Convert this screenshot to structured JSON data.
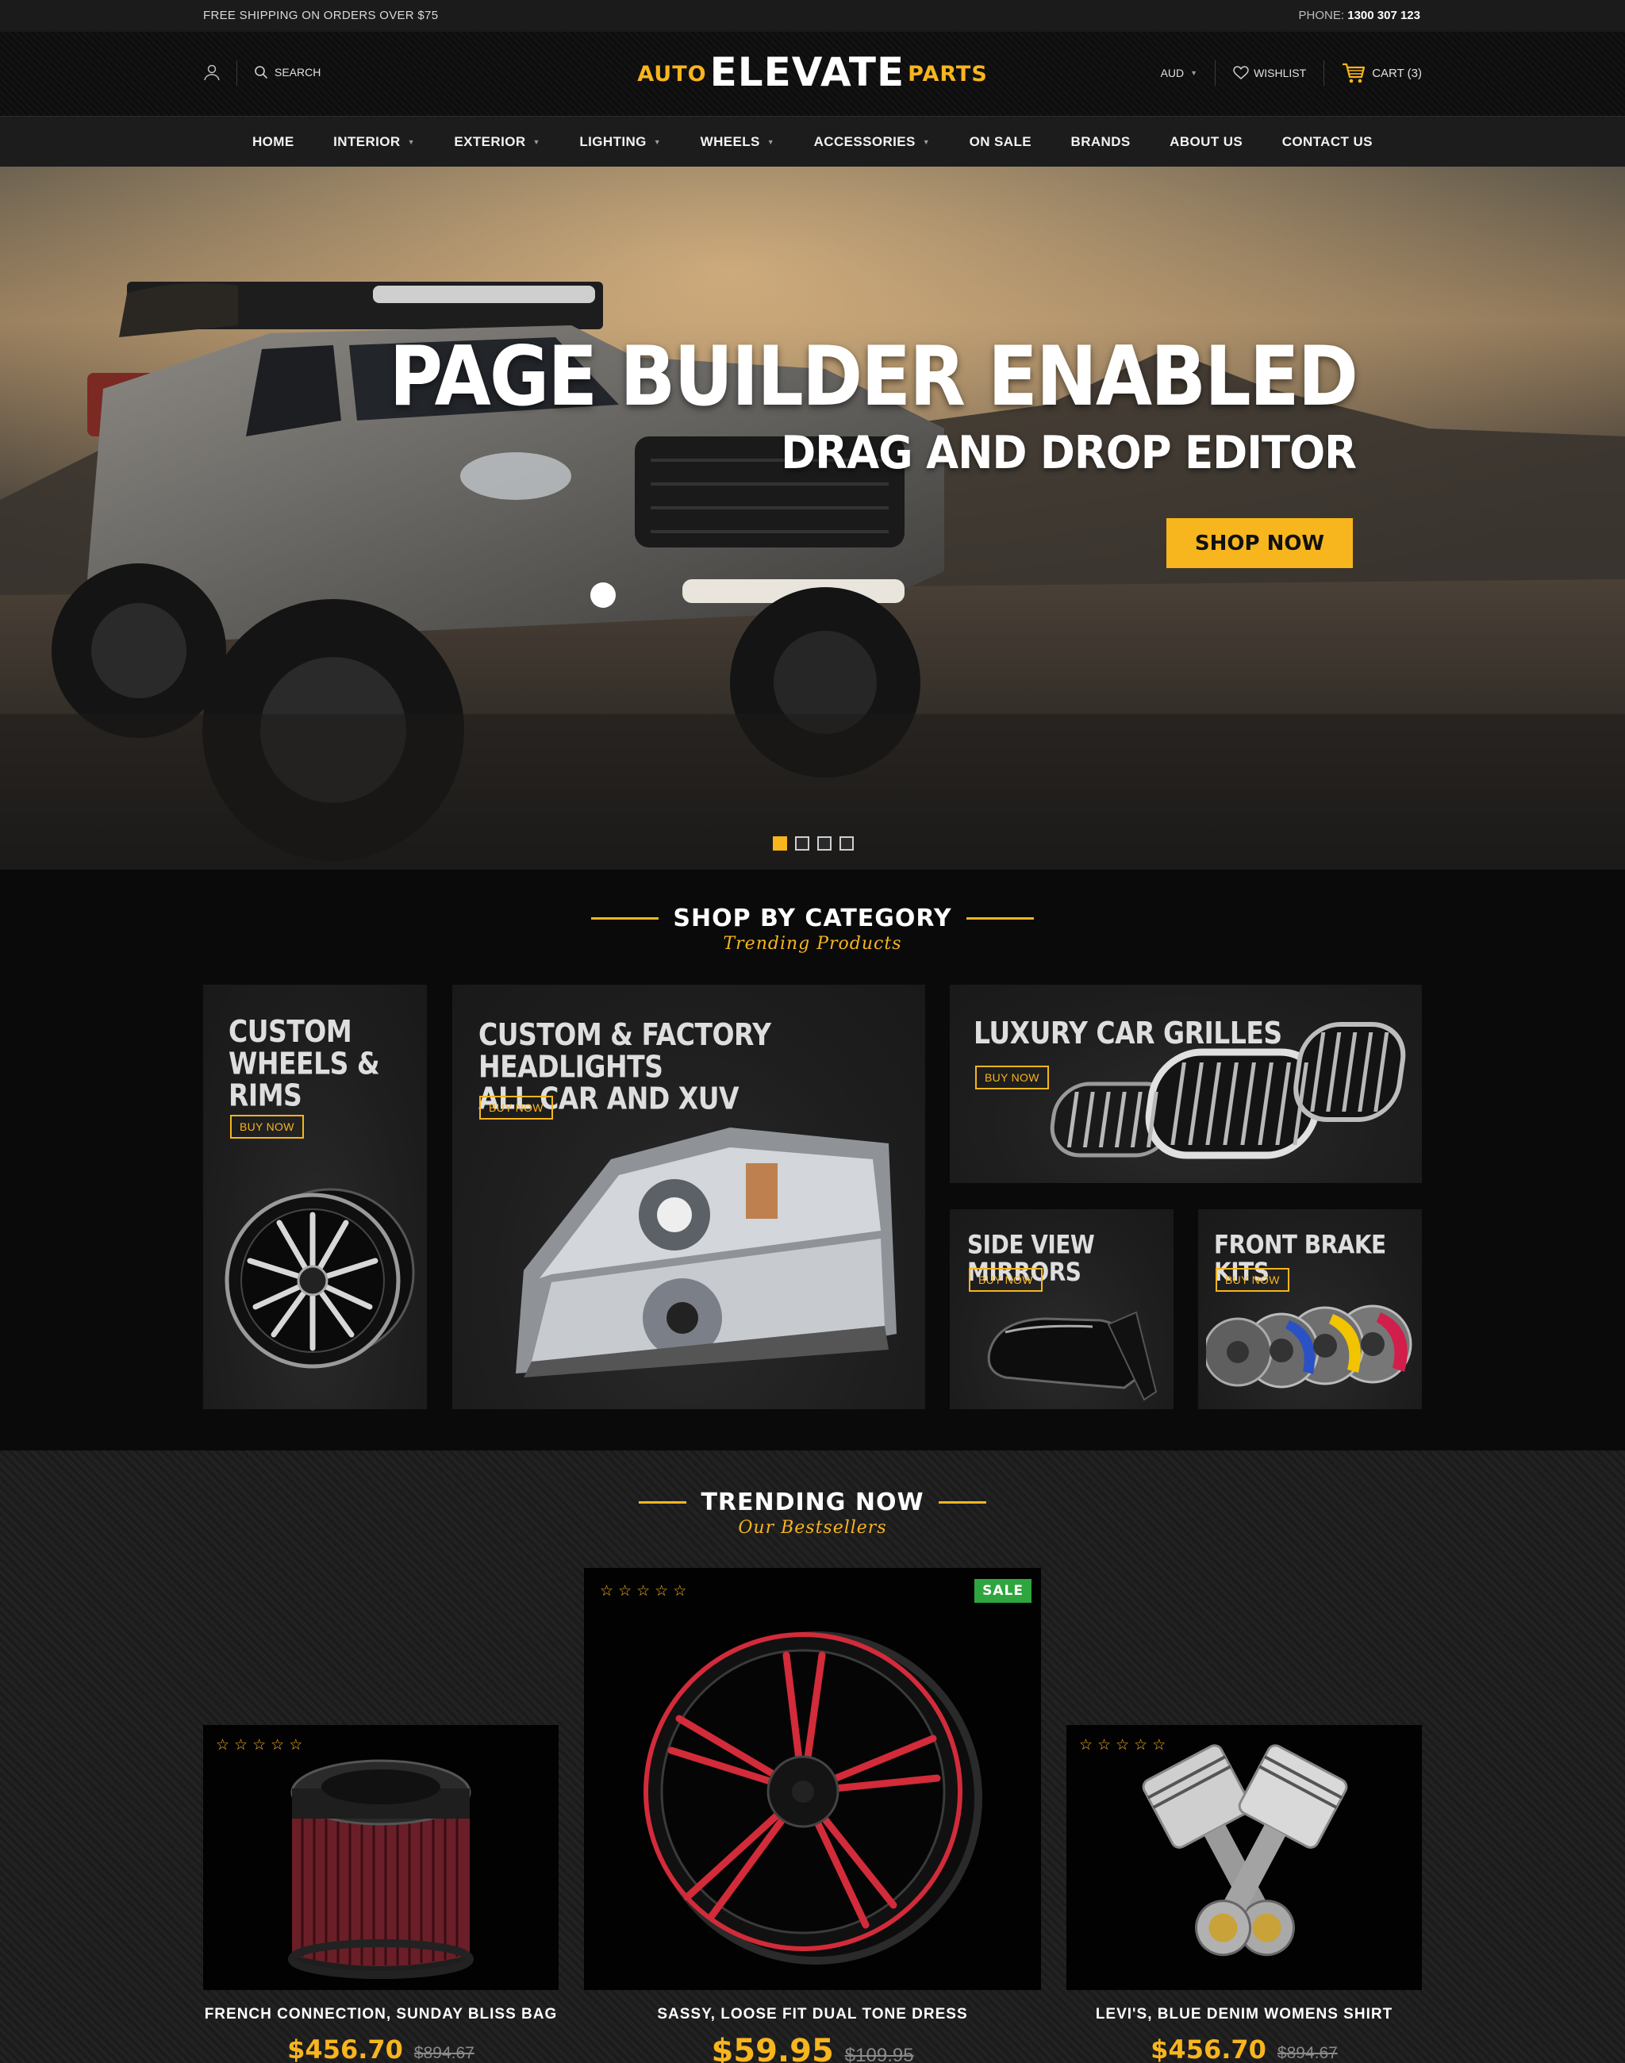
{
  "topbar": {
    "shipping": "FREE SHIPPING ON ORDERS OVER $75",
    "phone_label": "PHONE:",
    "phone_number": "1300 307 123"
  },
  "header": {
    "search_label": "SEARCH",
    "logo": {
      "left": "AUTO",
      "center": "ELEVATE",
      "right": "PARTS"
    },
    "currency": "AUD",
    "wishlist": "WISHLIST",
    "cart": "CART (3)"
  },
  "nav": [
    {
      "label": "HOME",
      "dropdown": false
    },
    {
      "label": "INTERIOR",
      "dropdown": true
    },
    {
      "label": "EXTERIOR",
      "dropdown": true
    },
    {
      "label": "LIGHTING",
      "dropdown": true
    },
    {
      "label": "WHEELS",
      "dropdown": true
    },
    {
      "label": "ACCESSORIES",
      "dropdown": true
    },
    {
      "label": "ON SALE",
      "dropdown": false
    },
    {
      "label": "BRANDS",
      "dropdown": false
    },
    {
      "label": "ABOUT US",
      "dropdown": false
    },
    {
      "label": "CONTACT US",
      "dropdown": false
    }
  ],
  "hero": {
    "headline": "PAGE BUILDER ENABLED",
    "subheadline": "DRAG AND DROP EDITOR",
    "cta": "SHOP NOW",
    "slide_count": 4,
    "active_slide": 1
  },
  "category_section": {
    "title": "SHOP BY CATEGORY",
    "subtitle": "Trending Products",
    "cards": [
      {
        "title": "CUSTOM\nWHEELS &\nRIMS",
        "button": "BUY NOW"
      },
      {
        "title": "CUSTOM & FACTORY HEADLIGHTS\nALL CAR AND XUV",
        "button": "BUY NOW"
      },
      {
        "title": "LUXURY CAR GRILLES",
        "button": "BUY NOW"
      },
      {
        "title": "SIDE VIEW MIRRORS",
        "button": "BUY NOW"
      },
      {
        "title": "FRONT BRAKE KITS",
        "button": "BUY NOW"
      }
    ]
  },
  "trending_section": {
    "title": "TRENDING NOW",
    "subtitle": "Our Bestsellers",
    "products": [
      {
        "name": "FRENCH CONNECTION, SUNDAY BLISS BAG",
        "price": "$456.70",
        "old_price": "$894.67",
        "rating": 0
      },
      {
        "name": "SASSY, LOOSE FIT DUAL TONE DRESS",
        "price": "$59.95",
        "old_price": "$109.95",
        "rating": 0,
        "badge": "SALE"
      },
      {
        "name": "LEVI'S, BLUE DENIM WOMENS SHIRT",
        "price": "$456.70",
        "old_price": "$894.67",
        "rating": 0
      }
    ]
  },
  "colors": {
    "accent": "#f7b51e",
    "sale_badge": "#2ea53e",
    "background": "#0b0b0b"
  }
}
